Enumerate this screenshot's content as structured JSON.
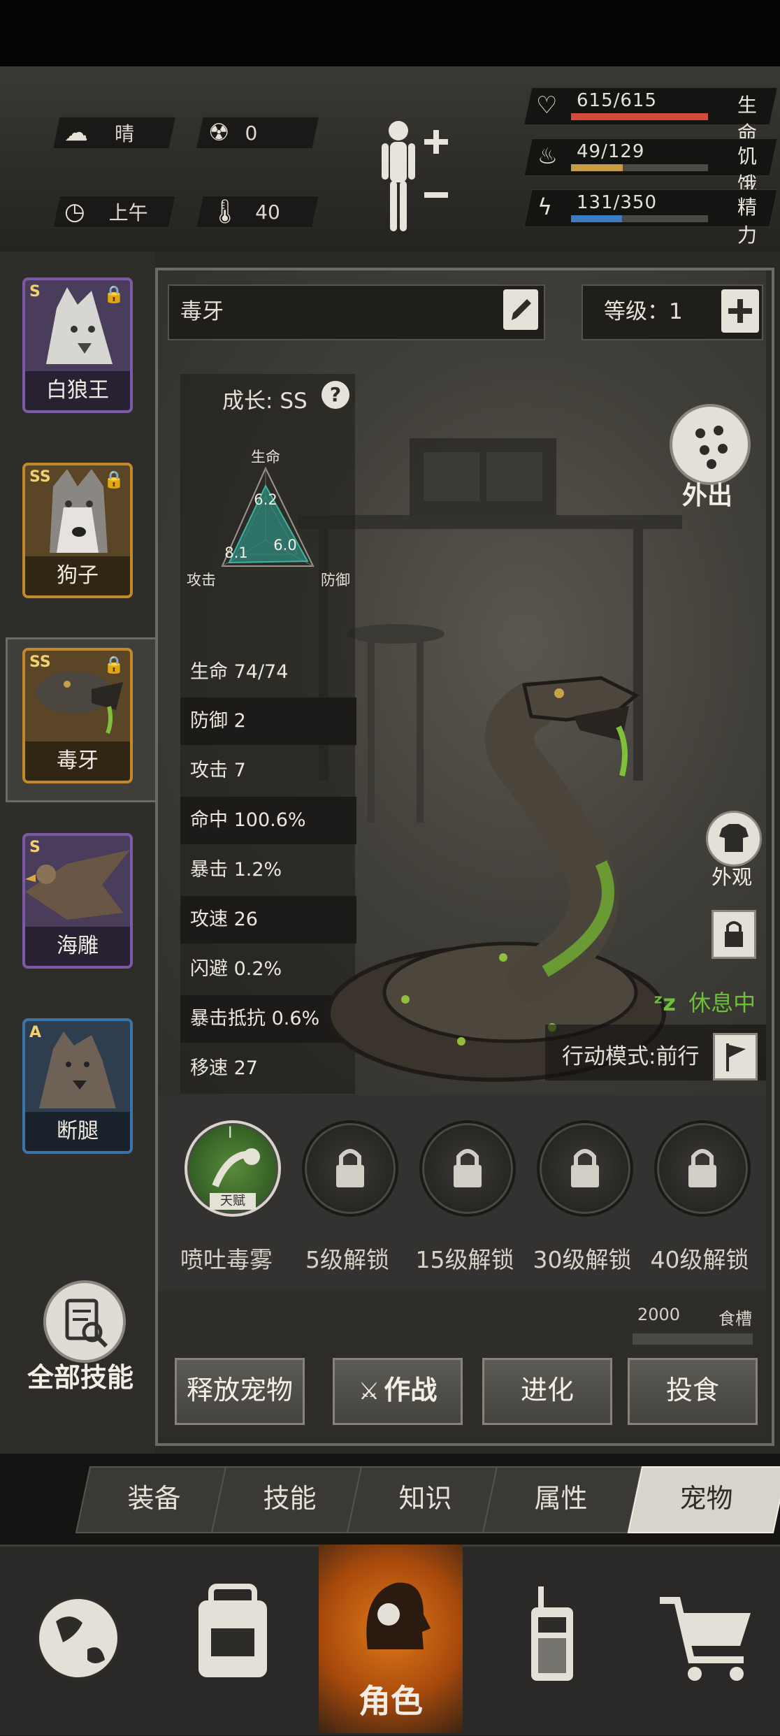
{
  "status": {
    "weather": "晴",
    "radiation": "0",
    "time_of_day": "上午",
    "temperature": "40"
  },
  "vitals": [
    {
      "value": "615/615",
      "label": "生命",
      "fill": 1.0,
      "color": "#d24c3c",
      "icon": "heart-icon"
    },
    {
      "value": "49/129",
      "label": "饥饿",
      "fill": 0.38,
      "color": "#c79a45",
      "icon": "stomach-icon"
    },
    {
      "value": "131/350",
      "label": "精力",
      "fill": 0.37,
      "color": "#3a7cc4",
      "icon": "energy-icon"
    }
  ],
  "pets": [
    {
      "name": "白狼王",
      "rank": "S",
      "border": "#7d5aa8",
      "bg": "#4a3d5c"
    },
    {
      "name": "狗子",
      "rank": "SS",
      "border": "#c2892a",
      "bg": "#5a4526"
    },
    {
      "name": "毒牙",
      "rank": "SS",
      "border": "#c2892a",
      "bg": "#5a4526",
      "selected": true
    },
    {
      "name": "海雕",
      "rank": "S",
      "border": "#7d5aa8",
      "bg": "#4a3d5c"
    },
    {
      "name": "断腿",
      "rank": "A",
      "border": "#3a74a8",
      "bg": "#2f3e4e"
    }
  ],
  "pet_detail": {
    "name": "毒牙",
    "level_label": "等级：",
    "level": "1",
    "growth_label": "成长:",
    "growth": "SS",
    "radar": {
      "axes": [
        "生命",
        "防御",
        "攻击"
      ],
      "values": [
        "6.2",
        "6.0",
        "8.1"
      ]
    },
    "stats": [
      {
        "label": "生命",
        "value": "74/74"
      },
      {
        "label": "防御",
        "value": "2"
      },
      {
        "label": "攻击",
        "value": "7"
      },
      {
        "label": "命中",
        "value": "100.6%"
      },
      {
        "label": "暴击",
        "value": "1.2%"
      },
      {
        "label": "攻速",
        "value": "26"
      },
      {
        "label": "闪避",
        "value": "0.2%"
      },
      {
        "label": "暴击抵抗",
        "value": "0.6%"
      },
      {
        "label": "移速",
        "value": "27"
      }
    ],
    "go_out": "外出",
    "appearance": "外观",
    "status_text": "休息中",
    "action_mode": "行动模式:前行"
  },
  "skills": [
    {
      "label": "喷吐毒雾",
      "badge": "天赋",
      "tier": "I",
      "unlocked": true
    },
    {
      "label": "5级解锁",
      "unlocked": false
    },
    {
      "label": "15级解锁",
      "unlocked": false
    },
    {
      "label": "30级解锁",
      "unlocked": false
    },
    {
      "label": "40级解锁",
      "unlocked": false
    }
  ],
  "trough": {
    "value": "2000",
    "label": "食槽"
  },
  "all_skills": "全部技能",
  "actions": [
    "释放宠物",
    "作战",
    "进化",
    "投食"
  ],
  "tabs": [
    "装备",
    "技能",
    "知识",
    "属性",
    "宠物"
  ],
  "active_tab": "宠物",
  "bottom_nav": {
    "active_label": "角色",
    "items": [
      "globe-icon",
      "backpack-icon",
      "character-icon",
      "radio-icon",
      "cart-icon"
    ]
  }
}
